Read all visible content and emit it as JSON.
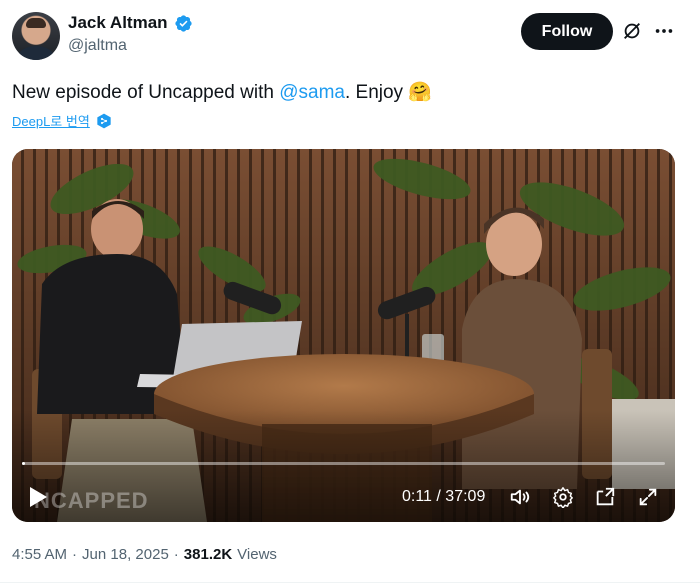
{
  "author": {
    "name": "Jack Altman",
    "handle": "@jaltma",
    "verified": true
  },
  "actions": {
    "follow_label": "Follow",
    "grok_icon": "grok-icon",
    "more_icon": "more-icon"
  },
  "tweet": {
    "text_before": "New episode of Uncapped with ",
    "mention": "@sama",
    "text_after": ". Enjoy ",
    "emoji": "🤗",
    "translate_label": "DeepL로 번역"
  },
  "video": {
    "watermark": "NCAPPED",
    "current_time": "0:11",
    "separator": " / ",
    "duration": "37:09",
    "progress_fraction": 0.005
  },
  "meta": {
    "time": "4:55 AM",
    "dot1": "·",
    "date": "Jun 18, 2025",
    "dot2": "·",
    "views_count": "381.2K",
    "views_label": "Views"
  },
  "colors": {
    "accent": "#1d9bf0",
    "text": "#0f1419",
    "muted": "#536471"
  }
}
